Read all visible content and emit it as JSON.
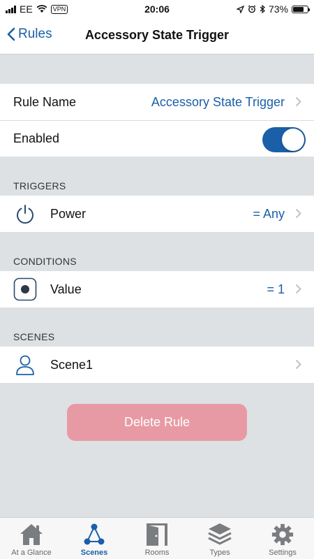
{
  "status_bar": {
    "carrier": "EE",
    "vpn": "VPN",
    "time": "20:06",
    "battery": "73%",
    "battery_level": 0.73
  },
  "nav": {
    "back_label": "Rules",
    "title": "Accessory State Trigger"
  },
  "settings": {
    "rule_name_label": "Rule Name",
    "rule_name_value": "Accessory State Trigger",
    "enabled_label": "Enabled",
    "enabled": true
  },
  "triggers": {
    "header": "TRIGGERS",
    "items": [
      {
        "label": "Power",
        "value": "= Any",
        "icon": "power-icon"
      }
    ]
  },
  "conditions": {
    "header": "CONDITIONS",
    "items": [
      {
        "label": "Value",
        "value": "= 1",
        "icon": "radio-button-icon"
      }
    ]
  },
  "scenes": {
    "header": "SCENES",
    "items": [
      {
        "label": "Scene1",
        "icon": "person-icon"
      }
    ]
  },
  "delete_button": "Delete Rule",
  "tabs": [
    {
      "label": "At a Glance",
      "icon": "house-icon",
      "active": false
    },
    {
      "label": "Scenes",
      "icon": "scenes-icon",
      "active": true
    },
    {
      "label": "Rooms",
      "icon": "door-icon",
      "active": false
    },
    {
      "label": "Types",
      "icon": "layers-icon",
      "active": false
    },
    {
      "label": "Settings",
      "icon": "gear-icon",
      "active": false
    }
  ],
  "colors": {
    "accent": "#1a5fa8",
    "background": "#dde1e4",
    "delete": "#e89aa4"
  }
}
